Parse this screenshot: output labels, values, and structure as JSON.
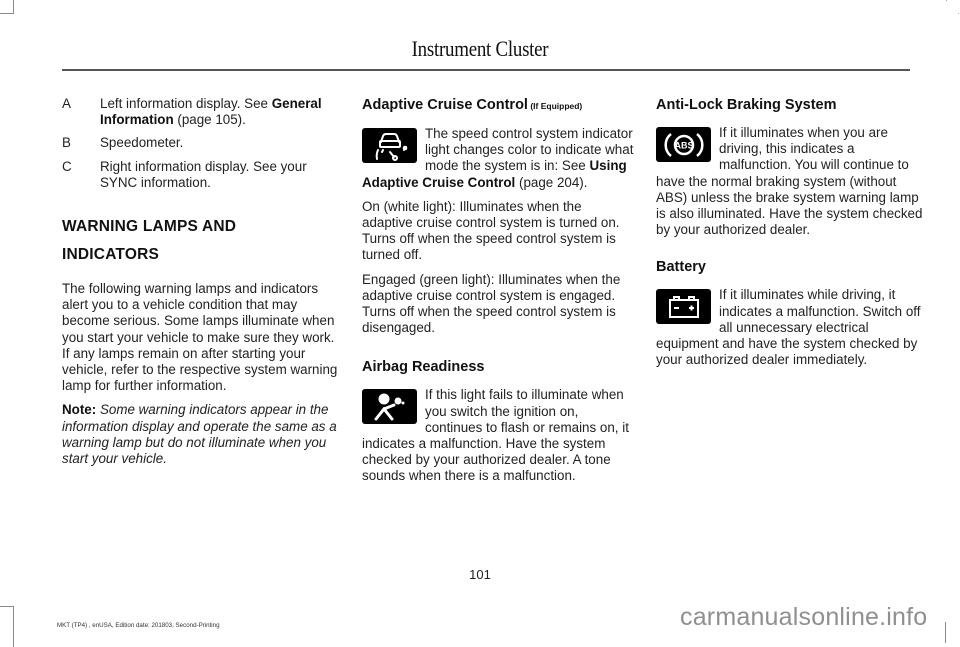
{
  "header": {
    "title": "Instrument Cluster"
  },
  "column_1": {
    "legend": [
      {
        "key": "A",
        "text": "Left information display.  See ",
        "link": "General Information",
        "suffix": " (page 105)."
      },
      {
        "key": "B",
        "text": "Speedometer."
      },
      {
        "key": "C",
        "text": "Right information display. See your SYNC information."
      }
    ],
    "section_heading_line1": "WARNING LAMPS AND",
    "section_heading_line2": "INDICATORS",
    "intro": "The following warning lamps and indicators alert you to a vehicle condition that may become serious.  Some lamps illuminate when you start your vehicle to make sure they work.  If any lamps remain on after starting your vehicle, refer to the respective system warning lamp for further information.",
    "note_label": "Note:",
    "note_text": " Some warning indicators appear in the information display and operate the same as a warning lamp but do not illuminate when you start your vehicle."
  },
  "column_2": {
    "acc": {
      "title": "Adaptive Cruise Control",
      "title_suffix": " (If Equipped)",
      "icon": "adaptive-cruise-control-icon",
      "intro": "The speed control system indicator light changes color to indicate what mode the system is in:  See ",
      "link": "Using Adaptive Cruise Control",
      "link_suffix": " (page 204).",
      "on_text": "On (white light): Illuminates when the adaptive cruise control system is turned on. Turns off when the speed control system is turned off.",
      "engaged_text": "Engaged (green light): Illuminates when the adaptive cruise control system is engaged. Turns off when the speed control system is disengaged."
    },
    "airbag": {
      "title": "Airbag Readiness",
      "icon": "airbag-icon",
      "text": "If this light fails to illuminate when you switch the ignition on, continues to flash or remains on, it indicates a malfunction. Have the system checked by your authorized dealer. A tone sounds when there is a malfunction."
    }
  },
  "column_3": {
    "abs": {
      "title": "Anti-Lock Braking System",
      "icon": "abs-icon",
      "icon_label": "ABS",
      "text": "If it illuminates when you are driving, this indicates a malfunction.  You will continue to have the normal braking system (without ABS) unless the brake system warning lamp is also illuminated.  Have the system checked by your authorized dealer."
    },
    "battery": {
      "title": "Battery",
      "icon": "battery-icon",
      "text": "If it illuminates while driving, it indicates a malfunction.  Switch off all unnecessary electrical equipment and have the system checked by your authorized dealer immediately."
    }
  },
  "footer": {
    "page_number": "101",
    "edition": "MKT (TP4) , enUSA, Edition date: 201803, Second-Printing",
    "watermark": "carmanualsonline.info"
  }
}
